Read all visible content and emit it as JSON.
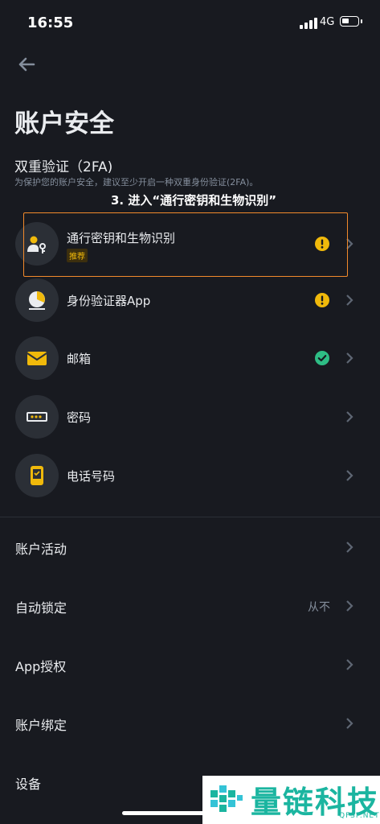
{
  "status_bar": {
    "time": "16:55",
    "network": "4G",
    "battery_level": 0.45
  },
  "header": {
    "title": "账户安全"
  },
  "twofa": {
    "title": "双重验证（2FA)",
    "description": "为保护您的账户安全，建议至少开启一种双重身份验证(2FA)。"
  },
  "annotation": "3. 进入“通行密钥和生物识别”",
  "methods": [
    {
      "label": "通行密钥和生物识别",
      "tag": "推荐",
      "icon": "passkey-icon",
      "status": "warning"
    },
    {
      "label": "身份验证器App",
      "icon": "authenticator-icon",
      "status": "warning"
    },
    {
      "label": "邮箱",
      "icon": "email-icon",
      "status": "verified"
    },
    {
      "label": "密码",
      "icon": "password-icon",
      "status": "none"
    },
    {
      "label": "电话号码",
      "icon": "phone-icon",
      "status": "none"
    }
  ],
  "settings": [
    {
      "label": "账户活动",
      "value": ""
    },
    {
      "label": "自动锁定",
      "value": "从不"
    },
    {
      "label": "App授权",
      "value": ""
    },
    {
      "label": "账户绑定",
      "value": ""
    },
    {
      "label": "设备",
      "value": ""
    }
  ],
  "colors": {
    "background": "#181a20",
    "accent_yellow": "#f0b90b",
    "success_green": "#2ebd85",
    "highlight_orange": "#f28a2b"
  },
  "watermark": {
    "text": "量链科技",
    "sub": "QFSP.NET"
  }
}
